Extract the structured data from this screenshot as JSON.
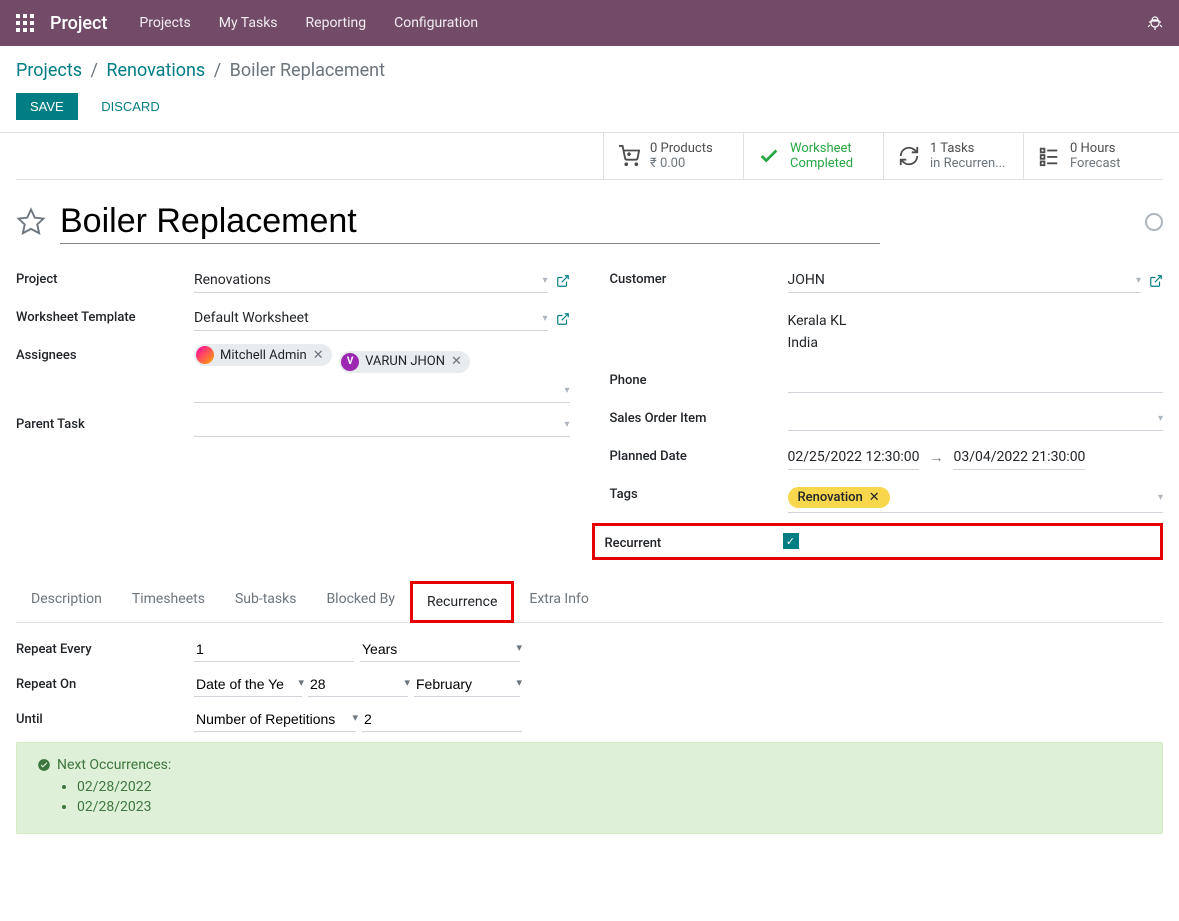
{
  "nav": {
    "brand": "Project",
    "items": [
      "Projects",
      "My Tasks",
      "Reporting",
      "Configuration"
    ]
  },
  "breadcrumb": {
    "l1": "Projects",
    "l2": "Renovations",
    "current": "Boiler Replacement"
  },
  "actions": {
    "save": "SAVE",
    "discard": "DISCARD"
  },
  "stats": {
    "products_count": "0 Products",
    "products_amount": "₹ 0.00",
    "worksheet_l1": "Worksheet",
    "worksheet_l2": "Completed",
    "tasks_count": "1 Tasks",
    "tasks_sub": "in Recurren...",
    "hours_count": "0   Hours",
    "hours_sub": "Forecast"
  },
  "title": "Boiler Replacement",
  "fields": {
    "project_label": "Project",
    "project_value": "Renovations",
    "worksheet_template_label": "Worksheet Template",
    "worksheet_template_value": "Default Worksheet",
    "assignees_label": "Assignees",
    "assignee1": "Mitchell Admin",
    "assignee2": "VARUN JHON",
    "assignee2_initial": "V",
    "parent_task_label": "Parent Task",
    "customer_label": "Customer",
    "customer_value": "JOHN",
    "address1": "Kerala KL",
    "address2": "India",
    "phone_label": "Phone",
    "soitem_label": "Sales Order Item",
    "planned_date_label": "Planned Date",
    "planned_start": "02/25/2022 12:30:00",
    "planned_end": "03/04/2022 21:30:00",
    "tags_label": "Tags",
    "tag_value": "Renovation",
    "recurrent_label": "Recurrent"
  },
  "tabs": {
    "t1": "Description",
    "t2": "Timesheets",
    "t3": "Sub-tasks",
    "t4": "Blocked By",
    "t5": "Recurrence",
    "t6": "Extra Info"
  },
  "recurrence": {
    "repeat_every_label": "Repeat Every",
    "repeat_every_value": "1",
    "repeat_unit": "Years",
    "repeat_on_label": "Repeat On",
    "repeat_on_type": "Date of the Year",
    "repeat_on_day": "28",
    "repeat_on_month": "February",
    "until_label": "Until",
    "until_type": "Number of Repetitions",
    "until_value": "2"
  },
  "next_occurrences": {
    "heading": "Next Occurrences:",
    "d1": "02/28/2022",
    "d2": "02/28/2023"
  }
}
